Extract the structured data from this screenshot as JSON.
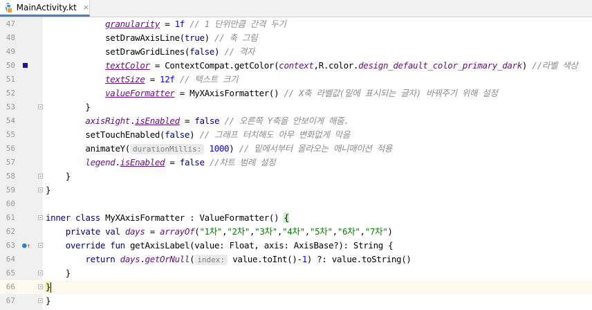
{
  "tab": {
    "title": "MainActivity.kt",
    "close": "×",
    "icon_glyph": "C",
    "icon": "kotlin-class-icon"
  },
  "colors": {
    "keyword": "#000080",
    "field": "#660e7a",
    "number": "#0000ff",
    "string": "#008000",
    "comment": "#8c8c8c",
    "gutter": "#f0f0f0",
    "breakpoint_marker": "#2a0aa6",
    "current_line": "#fcfaed"
  },
  "current_line": 66,
  "lines": [
    {
      "n": "47",
      "mark": "",
      "fold": false,
      "parts": [
        [
          "t",
          "            "
        ],
        [
          "fu",
          "granularity"
        ],
        [
          "t",
          " = "
        ],
        [
          "num",
          "1f"
        ],
        [
          "cm",
          " // 1 단위만큼 간격 두기"
        ]
      ]
    },
    {
      "n": "48",
      "mark": "",
      "fold": false,
      "parts": [
        [
          "t",
          "            setDrawAxisLine("
        ],
        [
          "k",
          "true"
        ],
        [
          "t",
          ")"
        ],
        [
          "cm",
          " // 축 그림"
        ]
      ]
    },
    {
      "n": "49",
      "mark": "",
      "fold": false,
      "parts": [
        [
          "t",
          "            setDrawGridLines("
        ],
        [
          "k",
          "false"
        ],
        [
          "t",
          ")"
        ],
        [
          "cm",
          " // 격자"
        ]
      ]
    },
    {
      "n": "50",
      "mark": "color",
      "fold": false,
      "parts": [
        [
          "t",
          "            "
        ],
        [
          "fu",
          "textColor"
        ],
        [
          "t",
          " = ContextCompat.getColor("
        ],
        [
          "fld",
          "context"
        ],
        [
          "t",
          ",R.color."
        ],
        [
          "fld",
          "design_default_color_primary_dark"
        ],
        [
          "t",
          ") "
        ],
        [
          "cm",
          "//라벨 색상"
        ]
      ]
    },
    {
      "n": "51",
      "mark": "",
      "fold": false,
      "parts": [
        [
          "t",
          "            "
        ],
        [
          "fu",
          "textSize"
        ],
        [
          "t",
          " = "
        ],
        [
          "num",
          "12f"
        ],
        [
          "cm",
          " // 텍스트 크기"
        ]
      ]
    },
    {
      "n": "52",
      "mark": "",
      "fold": false,
      "parts": [
        [
          "t",
          "            "
        ],
        [
          "fu",
          "valueFormatter"
        ],
        [
          "t",
          " = MyXAxisFormatter() "
        ],
        [
          "cm",
          "// X축 라벨값(밑에 표시되는 글자) 바꿔주기 위해 설정"
        ]
      ]
    },
    {
      "n": "53",
      "mark": "",
      "fold": true,
      "parts": [
        [
          "t",
          "        }"
        ]
      ]
    },
    {
      "n": "54",
      "mark": "",
      "fold": false,
      "parts": [
        [
          "t",
          "        "
        ],
        [
          "fld",
          "axisRight"
        ],
        [
          "t",
          "."
        ],
        [
          "fu",
          "isEnabled"
        ],
        [
          "t",
          " = "
        ],
        [
          "k",
          "false"
        ],
        [
          "cm",
          " // 오른쪽 Y축을 안보이게 해줌."
        ]
      ]
    },
    {
      "n": "55",
      "mark": "",
      "fold": false,
      "parts": [
        [
          "t",
          "        setTouchEnabled("
        ],
        [
          "k",
          "false"
        ],
        [
          "t",
          ")"
        ],
        [
          "cm",
          " // 그래프 터치해도 아무 변화없게 막음"
        ]
      ]
    },
    {
      "n": "56",
      "mark": "",
      "fold": false,
      "parts": [
        [
          "t",
          "        animateY("
        ],
        [
          "hint",
          "durationMillis:"
        ],
        [
          "t",
          " "
        ],
        [
          "num",
          "1000"
        ],
        [
          "t",
          ")"
        ],
        [
          "cm",
          " // 밑에서부터 올라오는 애니매이션 적용"
        ]
      ]
    },
    {
      "n": "57",
      "mark": "",
      "fold": false,
      "parts": [
        [
          "t",
          "        "
        ],
        [
          "fld",
          "legend"
        ],
        [
          "t",
          "."
        ],
        [
          "fu",
          "isEnabled"
        ],
        [
          "t",
          " = "
        ],
        [
          "k",
          "false"
        ],
        [
          "cm",
          " //차트 범례 설정"
        ]
      ]
    },
    {
      "n": "58",
      "mark": "",
      "fold": true,
      "parts": [
        [
          "t",
          "    }"
        ]
      ]
    },
    {
      "n": "59",
      "mark": "",
      "fold": true,
      "parts": [
        [
          "t",
          "}"
        ]
      ]
    },
    {
      "n": "60",
      "mark": "",
      "fold": false,
      "parts": []
    },
    {
      "n": "61",
      "mark": "",
      "fold": true,
      "parts": [
        [
          "k",
          "inner class "
        ],
        [
          "t",
          "MyXAxisFormatter : ValueFormatter() "
        ],
        [
          "bh",
          "{"
        ]
      ]
    },
    {
      "n": "62",
      "mark": "",
      "fold": false,
      "parts": [
        [
          "t",
          "    "
        ],
        [
          "k",
          "private val "
        ],
        [
          "fld",
          "days"
        ],
        [
          "t",
          " = "
        ],
        [
          "fi",
          "arrayOf"
        ],
        [
          "t",
          "("
        ],
        [
          "str",
          "\"1차\""
        ],
        [
          "t",
          ","
        ],
        [
          "str",
          "\"2차\""
        ],
        [
          "t",
          ","
        ],
        [
          "str",
          "\"3차\""
        ],
        [
          "t",
          ","
        ],
        [
          "str",
          "\"4차\""
        ],
        [
          "t",
          ","
        ],
        [
          "str",
          "\"5차\""
        ],
        [
          "t",
          ","
        ],
        [
          "str",
          "\"6차\""
        ],
        [
          "t",
          ","
        ],
        [
          "str",
          "\"7차\""
        ],
        [
          "t",
          ")"
        ]
      ]
    },
    {
      "n": "63",
      "mark": "override",
      "fold": true,
      "parts": [
        [
          "t",
          "    "
        ],
        [
          "k",
          "override fun "
        ],
        [
          "t",
          "getAxisLabel(value: Float, axis: AxisBase?): String {"
        ]
      ]
    },
    {
      "n": "64",
      "mark": "",
      "fold": false,
      "parts": [
        [
          "t",
          "        "
        ],
        [
          "k",
          "return "
        ],
        [
          "fld",
          "days"
        ],
        [
          "t",
          "."
        ],
        [
          "fi",
          "getOrNull"
        ],
        [
          "t",
          "("
        ],
        [
          "hint",
          "index:"
        ],
        [
          "t",
          " value.toInt()-"
        ],
        [
          "num",
          "1"
        ],
        [
          "t",
          ") ?: value.toString()"
        ]
      ]
    },
    {
      "n": "65",
      "mark": "",
      "fold": true,
      "parts": [
        [
          "t",
          "    }"
        ]
      ]
    },
    {
      "n": "66",
      "mark": "",
      "fold": true,
      "parts": [
        [
          "bh2",
          "}"
        ],
        [
          "caret",
          ""
        ]
      ]
    },
    {
      "n": "67",
      "mark": "",
      "fold": true,
      "parts": [
        [
          "t",
          "}"
        ]
      ]
    }
  ]
}
